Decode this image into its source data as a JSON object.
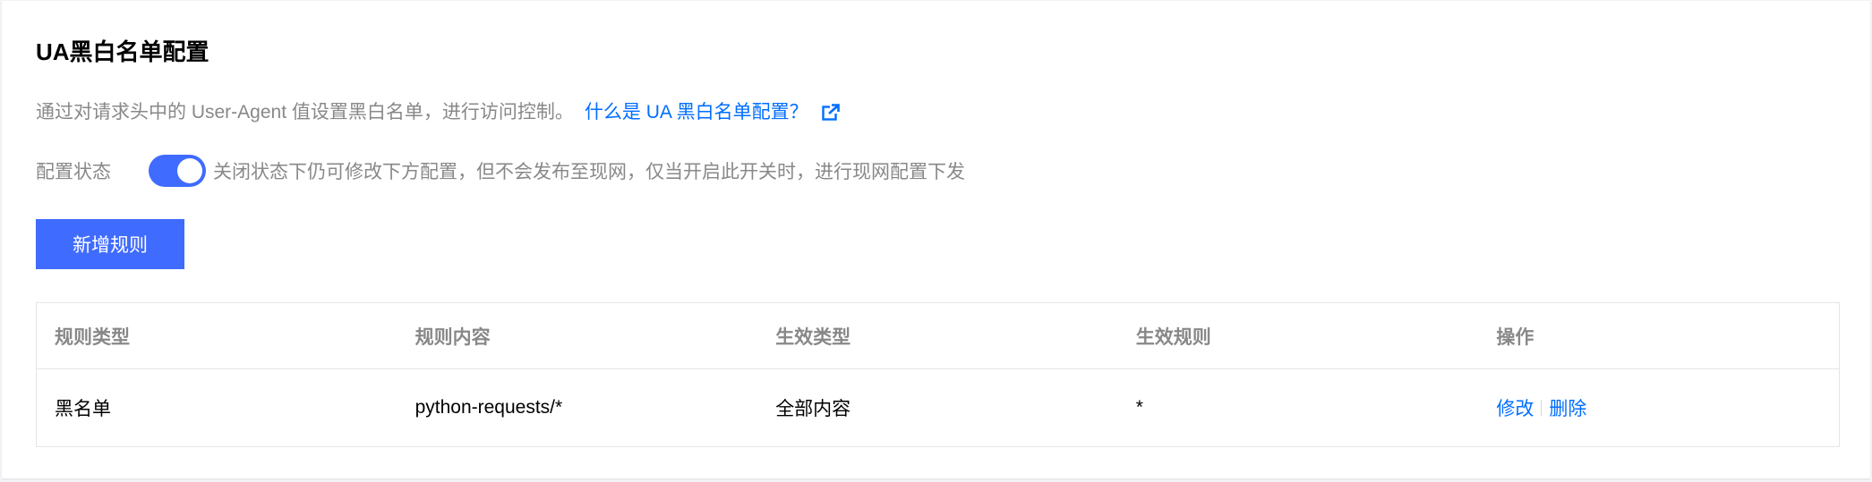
{
  "page": {
    "title": "UA黑白名单配置",
    "description": "通过对请求头中的 User-Agent 值设置黑白名单，进行访问控制。",
    "help_link": "什么是 UA 黑白名单配置？",
    "help_link_icon": "external-link-icon"
  },
  "status": {
    "label": "配置状态",
    "enabled": true,
    "hint": "关闭状态下仍可修改下方配置，但不会发布至现网，仅当开启此开关时，进行现网配置下发"
  },
  "toolbar": {
    "add_label": "新增规则"
  },
  "table": {
    "columns": [
      "规则类型",
      "规则内容",
      "生效类型",
      "生效规则",
      "操作"
    ],
    "rows": [
      {
        "rule_type": "黑名单",
        "rule_content": "python-requests/*",
        "effect_type": "全部内容",
        "effect_rule": "*",
        "edit_label": "修改",
        "delete_label": "删除"
      }
    ]
  },
  "colors": {
    "primary": "#3f6bff",
    "link": "#006eff",
    "muted_text": "#888888"
  }
}
